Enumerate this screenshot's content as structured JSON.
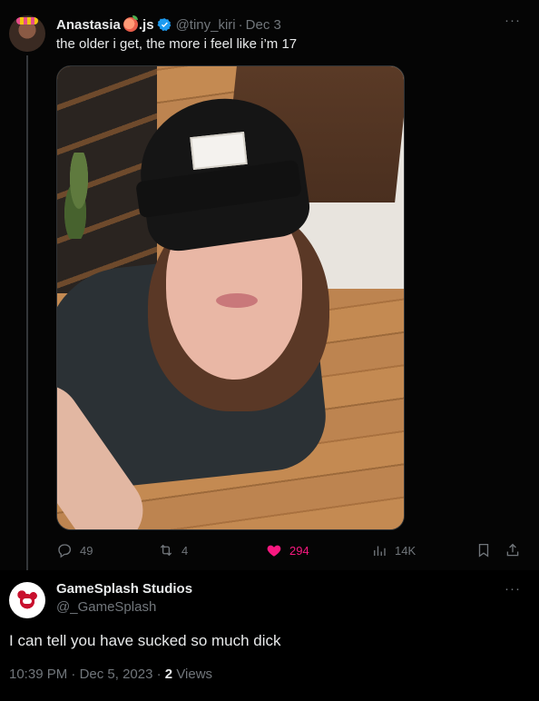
{
  "parent_tweet": {
    "author_name": "Anastasia",
    "name_suffix": ".js",
    "handle": "@tiny_kiri",
    "separator": "·",
    "date": "Dec 3",
    "text": "the older i get, the more i feel like i’m 17",
    "more": "···",
    "stats": {
      "replies": "49",
      "retweets": "4",
      "likes": "294",
      "views": "14K"
    },
    "icons": {
      "reply": "reply-icon",
      "retweet": "retweet-icon",
      "like": "heart-icon",
      "views": "views-icon",
      "bookmark": "bookmark-icon",
      "share": "share-icon",
      "verified": "verified-badge-icon",
      "emoji": "peach-emoji-icon"
    },
    "colors": {
      "like": "#f91880",
      "verified": "#1d9bf0",
      "muted": "#71767b"
    }
  },
  "reply_tweet": {
    "author_name": "GameSplash Studios",
    "handle": "@_GameSplash",
    "more": "···",
    "text": "I can tell you have sucked so much dick",
    "time": "10:39 PM",
    "date": "Dec 5, 2023",
    "separator": "·",
    "views_count": "2",
    "views_label": "Views"
  }
}
